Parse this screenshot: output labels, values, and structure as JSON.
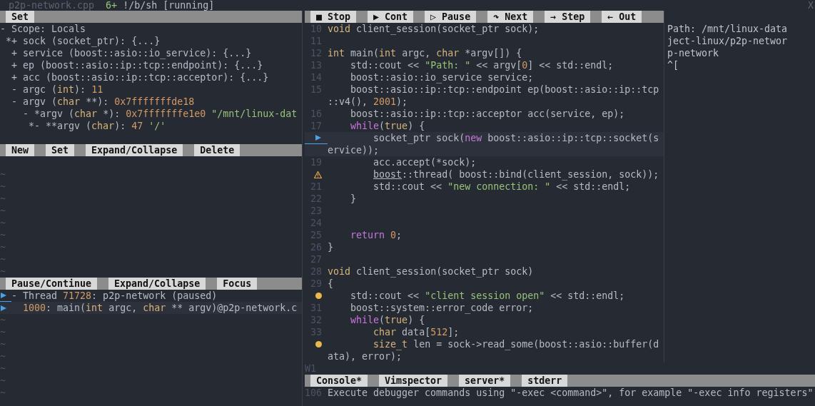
{
  "tabline": {
    "file": "p2p-network.cpp",
    "terminal_number": "6+",
    "terminal": "!/b/sh [running]",
    "close": "X"
  },
  "variables": {
    "toolbar": [
      "Set"
    ],
    "tree": [
      {
        "marker": "-",
        "segments": [
          {
            "text": "Scope: Locals",
            "kind": "plain"
          }
        ],
        "children": [
          {
            "marker": "*+",
            "segments": [
              {
                "text": "sock (socket_ptr): {...}",
                "kind": "plain"
              }
            ]
          },
          {
            "marker": "+",
            "segments": [
              {
                "text": "service (boost::asio::io_service): {...}",
                "kind": "plain"
              }
            ]
          },
          {
            "marker": "+",
            "segments": [
              {
                "text": "ep (boost::asio::ip::tcp::endpoint): {...}",
                "kind": "plain"
              }
            ]
          },
          {
            "marker": "+",
            "segments": [
              {
                "text": "acc (boost::asio::ip::tcp::acceptor): {...}",
                "kind": "plain"
              }
            ]
          },
          {
            "marker": "-",
            "segments": [
              {
                "text": "argc (",
                "kind": "plain"
              },
              {
                "text": "int",
                "kind": "type"
              },
              {
                "text": "): ",
                "kind": "plain"
              },
              {
                "text": "11",
                "kind": "number"
              }
            ]
          },
          {
            "marker": "-",
            "segments": [
              {
                "text": "argv (",
                "kind": "plain"
              },
              {
                "text": "char",
                "kind": "type"
              },
              {
                "text": " **): ",
                "kind": "plain"
              },
              {
                "text": "0x7fffffffde18",
                "kind": "number"
              }
            ],
            "children": [
              {
                "marker": "-",
                "segments": [
                  {
                    "text": "*argv (",
                    "kind": "plain"
                  },
                  {
                    "text": "char",
                    "kind": "type"
                  },
                  {
                    "text": " *): ",
                    "kind": "plain"
                  },
                  {
                    "text": "0x7fffffffe1e0",
                    "kind": "number"
                  },
                  {
                    "text": " \"/mnt/linux-dat",
                    "kind": "string"
                  }
                ],
                "children": [
                  {
                    "marker": "*-",
                    "segments": [
                      {
                        "text": "**argv (",
                        "kind": "plain"
                      },
                      {
                        "text": "char",
                        "kind": "type"
                      },
                      {
                        "text": "): ",
                        "kind": "plain"
                      },
                      {
                        "text": "47",
                        "kind": "number"
                      },
                      {
                        "text": " '/'",
                        "kind": "string"
                      }
                    ]
                  }
                ]
              }
            ]
          }
        ]
      }
    ]
  },
  "watches": {
    "toolbar": [
      "New",
      "Set",
      "Expand/Collapse",
      "Delete"
    ],
    "empty_rows": [
      "~",
      "~",
      "~",
      "~",
      "~",
      "~",
      "~",
      "~",
      "~"
    ]
  },
  "stack": {
    "toolbar": [
      "Pause/Continue",
      "Expand/Collapse",
      "Focus"
    ],
    "threads": [
      {
        "marker": "-",
        "current": true,
        "segments": [
          {
            "text": "Thread ",
            "kind": "plain"
          },
          {
            "text": "71728",
            "kind": "number"
          },
          {
            "text": ": p2p-network (paused)",
            "kind": "plain"
          }
        ],
        "frames": [
          {
            "current": true,
            "segments": [
              {
                "text": "1000",
                "kind": "number"
              },
              {
                "text": ": main(",
                "kind": "plain"
              },
              {
                "text": "int",
                "kind": "type"
              },
              {
                "text": " argc, ",
                "kind": "plain"
              },
              {
                "text": "char",
                "kind": "type"
              },
              {
                "text": " ** argv)@p2p-network.c",
                "kind": "plain"
              }
            ]
          }
        ]
      }
    ],
    "empty_rows": [
      "~",
      "~",
      "~",
      "~",
      "~",
      "~",
      "~"
    ]
  },
  "code": {
    "toolbar": [
      "■ Stop",
      "▶ Cont",
      "▷ Pause",
      "↷ Next",
      "→ Step",
      "← Out"
    ],
    "rows": [
      {
        "kind": "line",
        "number": "10",
        "segments": [
          {
            "text": "void",
            "kind": "type"
          },
          {
            "text": " client_session(socket_ptr sock);",
            "kind": "plain"
          }
        ]
      },
      {
        "kind": "line",
        "number": "11"
      },
      {
        "kind": "line",
        "number": "12",
        "segments": [
          {
            "text": "int",
            "kind": "type"
          },
          {
            "text": " main(",
            "kind": "plain"
          },
          {
            "text": "int",
            "kind": "type"
          },
          {
            "text": " argc, ",
            "kind": "plain"
          },
          {
            "text": "char",
            "kind": "type"
          },
          {
            "text": " *argv[]) {",
            "kind": "plain"
          }
        ]
      },
      {
        "kind": "line",
        "number": "13",
        "segments": [
          {
            "text": "    std::cout << ",
            "kind": "plain"
          },
          {
            "text": "\"Path: \"",
            "kind": "string"
          },
          {
            "text": " << argv[",
            "kind": "plain"
          },
          {
            "text": "0",
            "kind": "number"
          },
          {
            "text": "] << std::endl;",
            "kind": "plain"
          }
        ]
      },
      {
        "kind": "line",
        "number": "14",
        "segments": [
          {
            "text": "    boost::asio::io_service service;",
            "kind": "plain"
          }
        ]
      },
      {
        "kind": "line",
        "number": "15",
        "segments": [
          {
            "text": "    boost::asio::ip::tcp::endpoint ep(boost::asio::ip::tcp",
            "kind": "plain"
          }
        ]
      },
      {
        "kind": "wrap",
        "segments": [
          {
            "text": "::v4(), ",
            "kind": "plain"
          },
          {
            "text": "2001",
            "kind": "number"
          },
          {
            "text": ");",
            "kind": "plain"
          }
        ]
      },
      {
        "kind": "line",
        "number": "16",
        "segments": [
          {
            "text": "    boost::asio::ip::tcp::acceptor acc(service, ep);",
            "kind": "plain"
          }
        ]
      },
      {
        "kind": "line",
        "number": "17",
        "segments": [
          {
            "text": "    while",
            "kind": "keyword"
          },
          {
            "text": "(",
            "kind": "plain"
          },
          {
            "text": "true",
            "kind": "type"
          },
          {
            "text": ") {",
            "kind": "plain"
          }
        ]
      },
      {
        "kind": "current",
        "segments": [
          {
            "text": "        socket_ptr sock(",
            "kind": "plain"
          },
          {
            "text": "new",
            "kind": "keyword"
          },
          {
            "text": " boost::asio::ip::tcp::socket(s",
            "kind": "plain"
          }
        ]
      },
      {
        "kind": "current_wrap",
        "segments": [
          {
            "text": "ervice));",
            "kind": "plain"
          }
        ]
      },
      {
        "kind": "line",
        "number": "19",
        "segments": [
          {
            "text": "        acc.accept(*sock);",
            "kind": "plain"
          }
        ]
      },
      {
        "kind": "warning",
        "segments": [
          {
            "text": "        boost",
            "kind": "error"
          },
          {
            "text": "::thread( boost::bind(client_session, sock));",
            "kind": "plain"
          }
        ]
      },
      {
        "kind": "line",
        "number": "21",
        "segments": [
          {
            "text": "        std::cout << ",
            "kind": "plain"
          },
          {
            "text": "\"new connection: \"",
            "kind": "string"
          },
          {
            "text": " << std::endl;",
            "kind": "plain"
          }
        ]
      },
      {
        "kind": "line",
        "number": "22",
        "segments": [
          {
            "text": "    }",
            "kind": "plain"
          }
        ]
      },
      {
        "kind": "line",
        "number": "23"
      },
      {
        "kind": "line",
        "number": "24"
      },
      {
        "kind": "line",
        "number": "25",
        "segments": [
          {
            "text": "    return ",
            "kind": "keyword"
          },
          {
            "text": "0",
            "kind": "number"
          },
          {
            "text": ";",
            "kind": "plain"
          }
        ]
      },
      {
        "kind": "line",
        "number": "26",
        "segments": [
          {
            "text": "}",
            "kind": "plain"
          }
        ]
      },
      {
        "kind": "line",
        "number": "27"
      },
      {
        "kind": "line",
        "number": "28",
        "segments": [
          {
            "text": "void",
            "kind": "type"
          },
          {
            "text": " client_session(socket_ptr sock)",
            "kind": "plain"
          }
        ]
      },
      {
        "kind": "line",
        "number": "29",
        "segments": [
          {
            "text": "{",
            "kind": "plain"
          }
        ]
      },
      {
        "kind": "breakpoint",
        "segments": [
          {
            "text": "    std::cout << ",
            "kind": "plain"
          },
          {
            "text": "\"client session open\"",
            "kind": "string"
          },
          {
            "text": " << std::endl;",
            "kind": "plain"
          }
        ]
      },
      {
        "kind": "line",
        "number": "31",
        "segments": [
          {
            "text": "    boost::system::error_code error;",
            "kind": "plain"
          }
        ]
      },
      {
        "kind": "line",
        "number": "32",
        "segments": [
          {
            "text": "    while",
            "kind": "keyword"
          },
          {
            "text": "(",
            "kind": "plain"
          },
          {
            "text": "true",
            "kind": "type"
          },
          {
            "text": ") {",
            "kind": "plain"
          }
        ]
      },
      {
        "kind": "line",
        "number": "33",
        "segments": [
          {
            "text": "        char",
            "kind": "type"
          },
          {
            "text": " data[",
            "kind": "plain"
          },
          {
            "text": "512",
            "kind": "number"
          },
          {
            "text": "];",
            "kind": "plain"
          }
        ]
      },
      {
        "kind": "breakpoint",
        "segments": [
          {
            "text": "        size_t",
            "kind": "type"
          },
          {
            "text": " len = sock->read_some(boost::asio::buffer(d",
            "kind": "plain"
          }
        ]
      },
      {
        "kind": "wrap",
        "segments": [
          {
            "text": "ata), error);",
            "kind": "plain"
          }
        ]
      }
    ],
    "status": "W1"
  },
  "terminal": {
    "lines": [
      "Path: /mnt/linux-data",
      "ject-linux/p2p-networ",
      "p-network",
      "^["
    ]
  },
  "output_tabs": [
    "Console*",
    "Vimspector",
    "server*",
    "stderr"
  ],
  "console": {
    "number": "106",
    "text": "Execute debugger commands using \"-exec <command>\", for example \"-exec info registers\""
  }
}
